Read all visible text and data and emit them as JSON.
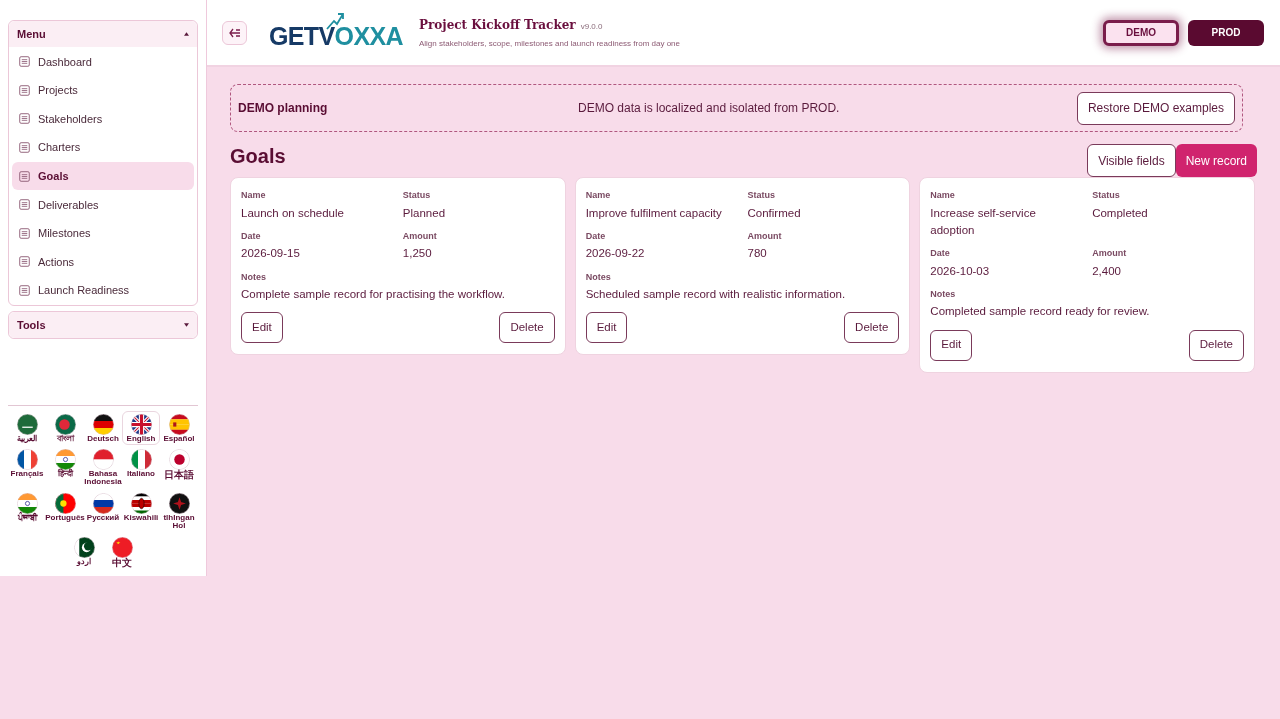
{
  "header": {
    "title": "Project Kickoff Tracker",
    "version": "v9.0.0",
    "subtitle": "Align stakeholders, scope, milestones and launch readiness from day one",
    "logo": {
      "part_1": "GET",
      "part_2": "V",
      "part_3": "OXXA"
    }
  },
  "environments": [
    {
      "label": "DEMO",
      "selected": true
    },
    {
      "label": "PROD",
      "selected": false
    }
  ],
  "sidebar": {
    "menu": {
      "title": "Menu",
      "expanded": true,
      "items": [
        {
          "label": "Dashboard",
          "selected": false
        },
        {
          "label": "Projects",
          "selected": false
        },
        {
          "label": "Stakeholders",
          "selected": false
        },
        {
          "label": "Charters",
          "selected": false
        },
        {
          "label": "Goals",
          "selected": true
        },
        {
          "label": "Deliverables",
          "selected": false
        },
        {
          "label": "Milestones",
          "selected": false
        },
        {
          "label": "Actions",
          "selected": false
        },
        {
          "label": "Launch Readiness",
          "selected": false
        }
      ]
    },
    "tools": {
      "title": "Tools",
      "expanded": false
    },
    "languages": [
      {
        "label": "العربية",
        "selected": false
      },
      {
        "label": "বাংলা",
        "selected": false
      },
      {
        "label": "Deutsch",
        "selected": false
      },
      {
        "label": "English",
        "selected": true
      },
      {
        "label": "Español",
        "selected": false
      },
      {
        "label": "Français",
        "selected": false
      },
      {
        "label": "हिन्दी",
        "selected": false
      },
      {
        "label": "Bahasa Indonesia",
        "selected": false
      },
      {
        "label": "Italiano",
        "selected": false
      },
      {
        "label": "日本語",
        "selected": false
      },
      {
        "label": "ਪੰਜਾਬੀ",
        "selected": false
      },
      {
        "label": "Português",
        "selected": false
      },
      {
        "label": "Русский",
        "selected": false
      },
      {
        "label": "Kiswahili",
        "selected": false
      },
      {
        "label": "tlhIngan Hol",
        "selected": false
      },
      {
        "label": "اردو",
        "selected": false
      },
      {
        "label": "中文",
        "selected": false
      }
    ]
  },
  "banner": {
    "title": "DEMO planning",
    "message": "DEMO data is localized and isolated from PROD.",
    "button": "Restore DEMO examples"
  },
  "section": {
    "title": "Goals",
    "buttons": [
      "Visible fields",
      "New record"
    ]
  },
  "records": [
    {
      "fields": [
        {
          "label": "Name",
          "value": "Launch on schedule"
        },
        {
          "label": "Status",
          "value": "Planned"
        },
        {
          "label": "Date",
          "value": "2026-09-15"
        },
        {
          "label": "Amount",
          "value": "1,250"
        }
      ],
      "notes_label": "Notes",
      "notes": "Complete sample record for practising the workflow.",
      "actions": [
        "Edit",
        "Delete"
      ]
    },
    {
      "fields": [
        {
          "label": "Name",
          "value": "Improve fulfilment capacity"
        },
        {
          "label": "Status",
          "value": "Confirmed"
        },
        {
          "label": "Date",
          "value": "2026-09-22"
        },
        {
          "label": "Amount",
          "value": "780"
        }
      ],
      "notes_label": "Notes",
      "notes": "Scheduled sample record with realistic information.",
      "actions": [
        "Edit",
        "Delete"
      ]
    },
    {
      "fields": [
        {
          "label": "Name",
          "value": "Increase self-service adoption"
        },
        {
          "label": "Status",
          "value": "Completed"
        },
        {
          "label": "Date",
          "value": "2026-10-03"
        },
        {
          "label": "Amount",
          "value": "2,400"
        }
      ],
      "notes_label": "Notes",
      "notes": "Completed sample record ready for review.",
      "actions": [
        "Edit",
        "Delete"
      ]
    }
  ]
}
